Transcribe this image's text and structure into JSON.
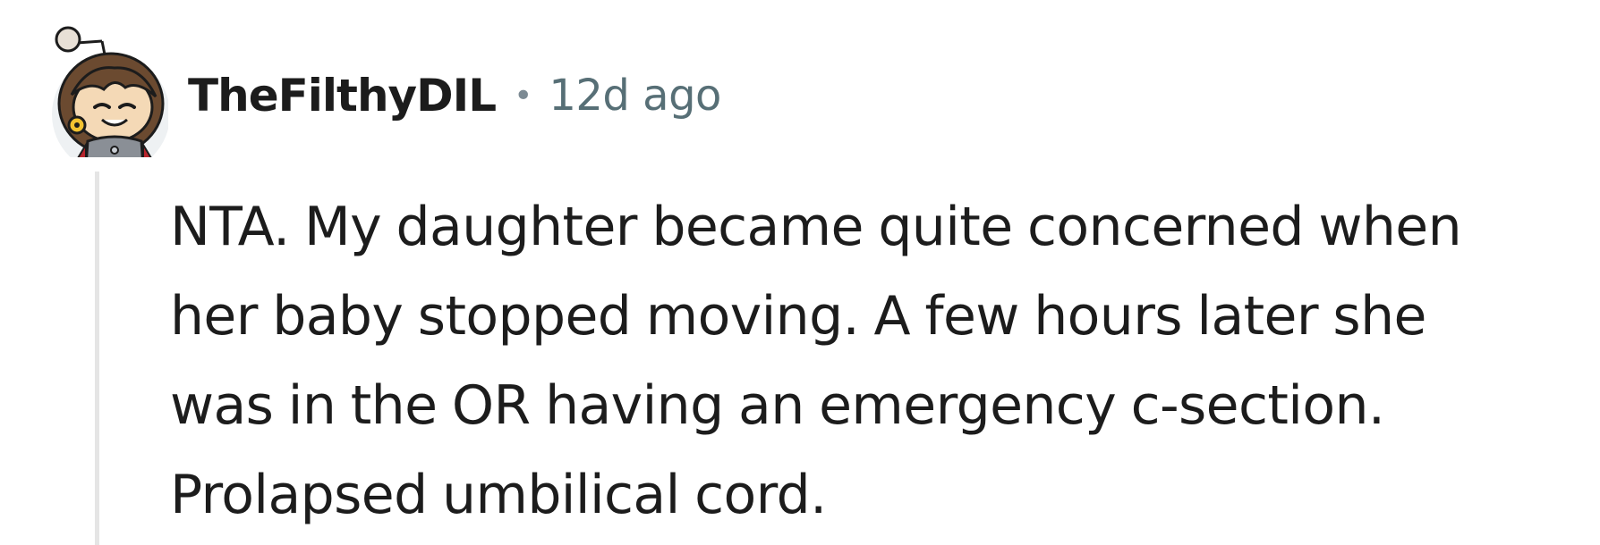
{
  "comment": {
    "author": "TheFilthyDIL",
    "separator": "•",
    "timestamp": "12d ago",
    "avatar_icon": "snoo-avatar-icon",
    "body_lines": [
      "NTA. My daughter became quite concerned when",
      "her baby stopped moving. A few hours later she",
      "was in the OR having an emergency c-section.",
      "Prolapsed umbilical cord."
    ]
  },
  "colors": {
    "text_primary": "#1c1c1c",
    "text_meta": "#576f76",
    "thread_line": "#e5e5e5",
    "background": "#ffffff"
  }
}
